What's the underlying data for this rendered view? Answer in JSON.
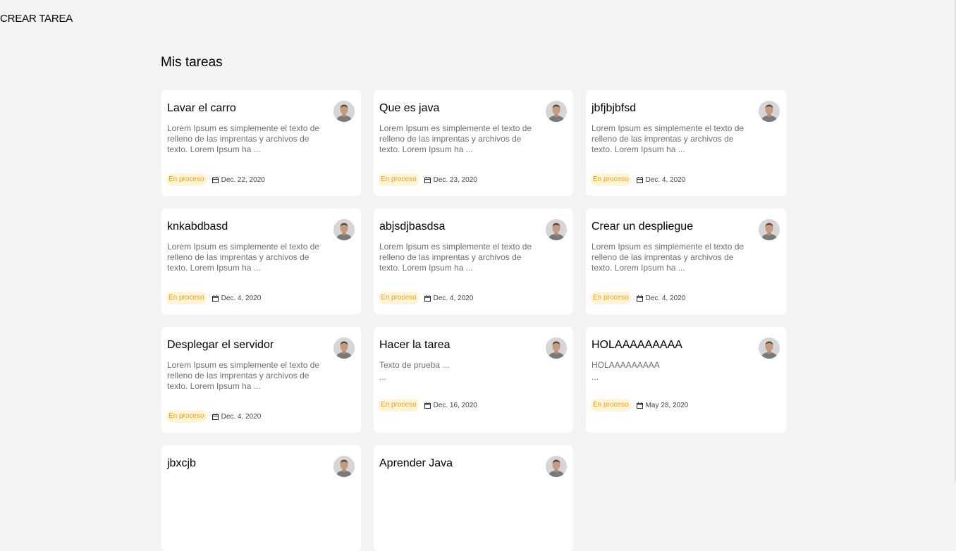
{
  "header": {
    "create_label": "CREAR TAREA"
  },
  "main": {
    "title": "Mis tareas"
  },
  "tasks": [
    {
      "title": "Lavar el carro",
      "description": "Lorem Ipsum es simplemente el texto de relleno de las imprentas y archivos de texto. Lorem Ipsum ha ...",
      "extra": "",
      "status": "En proceso",
      "date": "Dec. 22, 2020"
    },
    {
      "title": "Que es java",
      "description": "Lorem Ipsum es simplemente el texto de relleno de las imprentas y archivos de texto. Lorem Ipsum ha ...",
      "extra": "",
      "status": "En proceso",
      "date": "Dec. 23, 2020"
    },
    {
      "title": "jbfjbjbfsd",
      "description": "Lorem Ipsum es simplemente el texto de relleno de las imprentas y archivos de texto. Lorem Ipsum ha ...",
      "extra": "",
      "status": "En proceso",
      "date": "Dec. 4, 2020"
    },
    {
      "title": "knkabdbasd",
      "description": "Lorem Ipsum es simplemente el texto de relleno de las imprentas y archivos de texto. Lorem Ipsum ha ...",
      "extra": "",
      "status": "En proceso",
      "date": "Dec. 4, 2020"
    },
    {
      "title": "abjsdjbasdsa",
      "description": "Lorem Ipsum es simplemente el texto de relleno de las imprentas y archivos de texto. Lorem Ipsum ha ...",
      "extra": "",
      "status": "En proceso",
      "date": "Dec. 4, 2020"
    },
    {
      "title": "Crear un despliegue",
      "description": "Lorem Ipsum es simplemente el texto de relleno de las imprentas y archivos de texto. Lorem Ipsum ha ...",
      "extra": "",
      "status": "En proceso",
      "date": "Dec. 4, 2020"
    },
    {
      "title": "Desplegar el servidor",
      "description": "Lorem Ipsum es simplemente el texto de relleno de las imprentas y archivos de texto. Lorem Ipsum ha ...",
      "extra": "",
      "status": "En proceso",
      "date": "Dec. 4, 2020"
    },
    {
      "title": "Hacer la tarea",
      "description": "Texto de prueba ...",
      "extra": "...",
      "status": "En proceso",
      "date": "Dec. 16, 2020"
    },
    {
      "title": "HOLAAAAAAAAA",
      "description": "HOLAAAAAAAAA",
      "extra": "...",
      "status": "En proceso",
      "date": "May 28, 2020"
    },
    {
      "title": "jbxcjb",
      "description": "",
      "extra": "",
      "status": "",
      "date": ""
    },
    {
      "title": "Aprender Java",
      "description": "",
      "extra": "",
      "status": "",
      "date": ""
    }
  ],
  "colors": {
    "background": "#f3f3f3",
    "card": "#ffffff",
    "badge_bg": "#fff3d9",
    "badge_text": "#e6a21c"
  },
  "icons": {
    "avatar": "user-avatar",
    "calendar": "calendar-icon"
  }
}
